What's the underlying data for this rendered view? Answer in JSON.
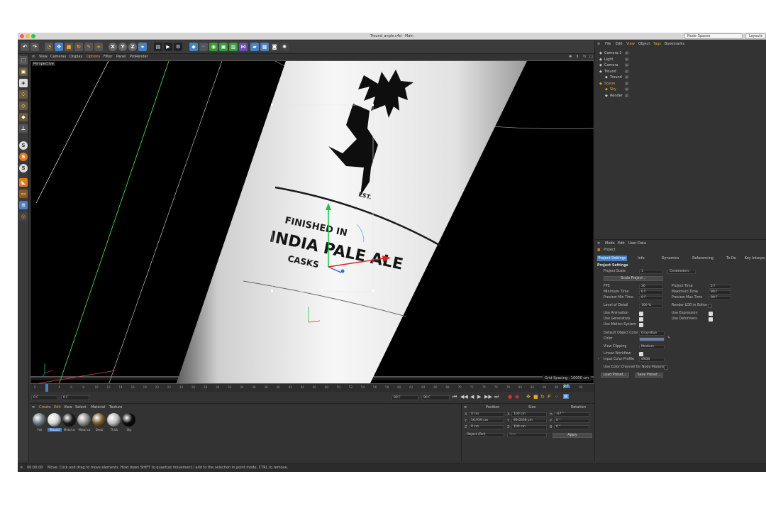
{
  "window": {
    "title": "Tround_angle.c4d - Main",
    "node_spaces": "Node Spaces",
    "layouts": "Layouts"
  },
  "viewport": {
    "menu": [
      "View",
      "Cameras",
      "Display",
      "Options",
      "Filter",
      "Panel",
      "ProRender"
    ],
    "mode_label": "Perspective",
    "grid_spacing": "Grid Spacing : 10000 cm",
    "label": {
      "finished": "FINISHED IN",
      "ipa": "INDIA PALE ALE",
      "casks": "CASKS",
      "est": "EST."
    }
  },
  "timeline": {
    "ticks": [
      "0",
      "2",
      "4",
      "6",
      "8",
      "10",
      "12",
      "14",
      "16",
      "18",
      "20",
      "22",
      "24",
      "26",
      "28",
      "30",
      "32",
      "34",
      "36",
      "38",
      "40",
      "42",
      "44",
      "46",
      "48",
      "50",
      "52",
      "54",
      "56",
      "58",
      "60",
      "62",
      "64",
      "66",
      "68",
      "70",
      "72",
      "74",
      "76",
      "78",
      "80",
      "82",
      "84",
      "86",
      "88",
      "90"
    ],
    "current_frame": "0 F",
    "start_field": "0 F",
    "start_field2": "0 F",
    "end_field": "90 F",
    "end_field2": "90 F",
    "frame_badge": "2 F"
  },
  "materials": {
    "menu": [
      "Create",
      "Edit",
      "View",
      "Select",
      "Material",
      "Texture"
    ],
    "items": [
      {
        "label": "Foil",
        "color": "#6f7a83"
      },
      {
        "label": "Tround",
        "color": "#d8d8d8"
      },
      {
        "label": "Metal ar",
        "color": "#1c1c1c"
      },
      {
        "label": "Metal ca",
        "color": "#8d8d8d"
      },
      {
        "label": "Deep",
        "color": "#7a5a2c"
      },
      {
        "label": "Thick",
        "color": "#bcbcbc"
      },
      {
        "label": "Sky",
        "color": "#0b0b0b"
      }
    ]
  },
  "coords": {
    "headers": [
      "Position",
      "Size",
      "Rotation"
    ],
    "rows": [
      {
        "axis": "X",
        "pos": "0 cm",
        "size_axis": "X",
        "size": "100 cm",
        "rot_axis": "H",
        "rot": "-67 °"
      },
      {
        "axis": "Y",
        "pos": "16.939 cm",
        "size_axis": "Y",
        "size": "89.0338 cm",
        "rot_axis": "P",
        "rot": "0 °"
      },
      {
        "axis": "Z",
        "pos": "0 cm",
        "size_axis": "Z",
        "size": "100 cm",
        "rot_axis": "B",
        "rot": "0 °"
      }
    ],
    "mode": "Object (Rel)",
    "size_mode": "Size",
    "apply": "Apply"
  },
  "objects": {
    "menu": [
      "File",
      "Edit",
      "View",
      "Object",
      "Tags",
      "Bookmarks"
    ],
    "rows": [
      {
        "name": "Camera.1",
        "indent": 0,
        "color": "#cccccc"
      },
      {
        "name": "Light",
        "indent": 0,
        "color": "#cccccc"
      },
      {
        "name": "Camera",
        "indent": 0,
        "color": "#cccccc"
      },
      {
        "name": "Tround",
        "indent": 0,
        "color": "#cccccc"
      },
      {
        "name": "Tround",
        "indent": 1,
        "color": "#cccccc"
      },
      {
        "name": "Scene",
        "indent": 0,
        "color": "#e4a33a"
      },
      {
        "name": "Sky",
        "indent": 1,
        "color": "#e4a33a"
      },
      {
        "name": "Render",
        "indent": 1,
        "color": "#cccccc"
      }
    ]
  },
  "attributes": {
    "menu": [
      "Mode",
      "Edit",
      "User Data"
    ],
    "object": "Project",
    "tabs": [
      "Project Settings",
      "Info",
      "Dynamics",
      "Referencing",
      "To Do",
      "Key Interpo"
    ],
    "section": "Project Settings",
    "project_scale_label": "Project Scale",
    "project_scale_value": "1",
    "project_scale_unit": "Centimeters",
    "scale_project_btn": "Scale Project...",
    "fps_label": "FPS",
    "fps_value": "30",
    "project_time_label": "Project Time",
    "project_time_value": "2 F",
    "min_time_label": "Minimum Time",
    "min_time_value": "0 F",
    "max_time_label": "Maximum Time",
    "max_time_value": "90 F",
    "prev_min_label": "Preview Min Time",
    "prev_min_value": "0 F",
    "prev_max_label": "Preview Max Time",
    "prev_max_value": "90 F",
    "lod_label": "Level of Detail",
    "lod_value": "100 %",
    "render_lod_label": "Render LOD in Editor",
    "use_animation": "Use Animation",
    "use_expression": "Use Expression",
    "use_generators": "Use Generators",
    "use_deformers": "Use Deformers",
    "use_motion": "Use Motion System",
    "default_color_label": "Default Object Color",
    "default_color_value": "Gray-Blue",
    "color_label": "Color",
    "view_clipping_label": "View Clipping",
    "view_clipping_value": "Medium",
    "linear_workflow": "Linear Workflow",
    "input_color_label": "Input Color Profile",
    "input_color_value": "sRGB",
    "node_material_label": "Use Color Channel for Node Material",
    "load_preset": "Load Preset...",
    "save_preset": "Save Preset..."
  },
  "status": {
    "time": "00:00:00",
    "message": "Move: Click and drag to move elements. Hold down SHIFT to quantize movement / add to the selection in point mode, CTRL to remove."
  }
}
